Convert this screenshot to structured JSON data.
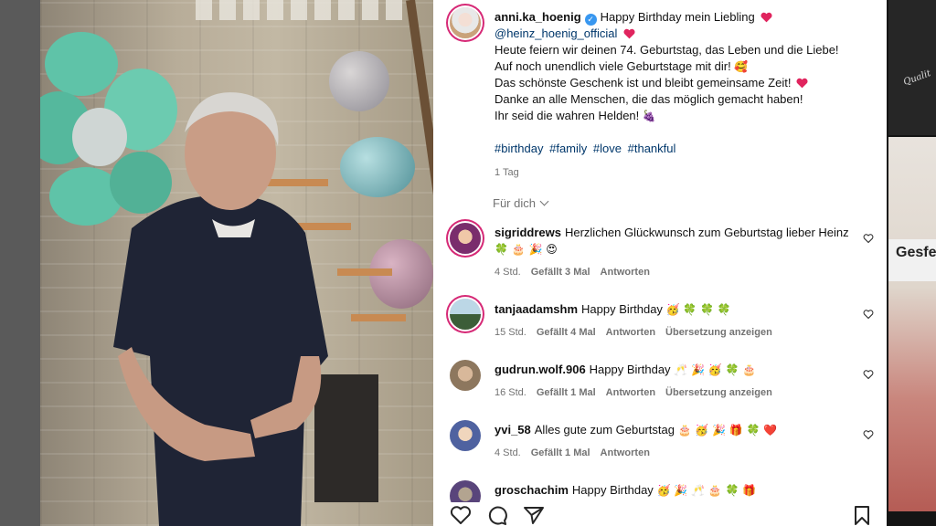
{
  "post": {
    "author": "anni.ka_hoenig",
    "verified": true,
    "caption_first": "Happy Birthday mein Liebling",
    "mention": "@heinz_hoenig_official",
    "lines": [
      "Heute feiern wir deinen 74. Geburtstag, das Leben und die Liebe!",
      "Auf noch unendlich viele Geburtstage mit dir!",
      "Das schönste Geschenk ist und bleibt gemeinsame Zeit!",
      "Danke an alle Menschen, die das möglich gemacht haben!",
      "Ihr seid die wahren Helden!"
    ],
    "hashtags": [
      "#birthday",
      "#family",
      "#love",
      "#thankful"
    ],
    "time": "1 Tag"
  },
  "filter_label": "Für dich",
  "comments": [
    {
      "user": "sigriddrews",
      "text": "Herzlichen Glückwunsch zum Geburtstag lieber Heinz",
      "emoji": "🍀 🎂 🎉 😍",
      "age": "4 Std.",
      "likes": "Gefällt 3 Mal",
      "reply": "Antworten",
      "translate": ""
    },
    {
      "user": "tanjaadamshm",
      "text": "Happy Birthday",
      "emoji": "🥳 🍀 🍀 🍀",
      "age": "15 Std.",
      "likes": "Gefällt 4 Mal",
      "reply": "Antworten",
      "translate": "Übersetzung anzeigen"
    },
    {
      "user": "gudrun.wolf.906",
      "text": "Happy Birthday",
      "emoji": "🥂 🎉 🥳 🍀 🎂",
      "age": "16 Std.",
      "likes": "Gefällt 1 Mal",
      "reply": "Antworten",
      "translate": "Übersetzung anzeigen"
    },
    {
      "user": "yvi_58",
      "text": "Alles gute zum Geburtstag",
      "emoji": "🎂 🥳 🎉 🎁 🍀 ❤️",
      "age": "4 Std.",
      "likes": "Gefällt 1 Mal",
      "reply": "Antworten",
      "translate": ""
    },
    {
      "user": "groschachim",
      "text": "Happy Birthday",
      "emoji": "🥳 🎉 🥂 🎂 🍀 🎁",
      "age": "",
      "likes": "",
      "reply": "",
      "translate": ""
    }
  ],
  "side": {
    "signature": "Qualit",
    "sign_text": "Gesfer"
  },
  "icons": {
    "like": "heart-icon",
    "comment": "comment-icon",
    "share": "send-icon",
    "save": "bookmark-icon"
  }
}
